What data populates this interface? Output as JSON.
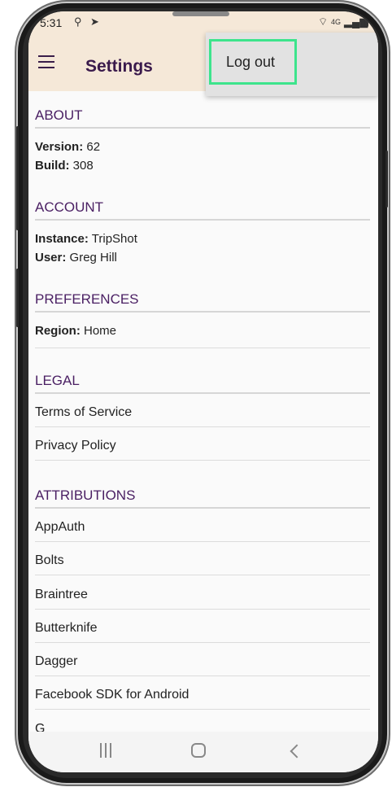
{
  "statusbar": {
    "time": "5:31",
    "location_icon": "location-icon",
    "nav_icon": "navigation-arrow-icon",
    "signal_text": "4G"
  },
  "appbar": {
    "title": "Settings",
    "menu_icon": "hamburger-menu-icon"
  },
  "overflow_menu": {
    "logout_label": "Log out"
  },
  "about": {
    "header": "ABOUT",
    "version_label": "Version:",
    "version_value": "62",
    "build_label": "Build:",
    "build_value": "308"
  },
  "account": {
    "header": "ACCOUNT",
    "instance_label": "Instance:",
    "instance_value": "TripShot",
    "user_label": "User:",
    "user_value": "Greg Hill"
  },
  "preferences": {
    "header": "PREFERENCES",
    "region_label": "Region:",
    "region_value": "Home"
  },
  "legal": {
    "header": "LEGAL",
    "items": [
      "Terms of Service",
      "Privacy Policy"
    ]
  },
  "attributions": {
    "header": "ATTRIBUTIONS",
    "items": [
      "AppAuth",
      "Bolts",
      "Braintree",
      "Butterknife",
      "Dagger",
      "Facebook SDK for Android",
      "G"
    ]
  },
  "navbar": {
    "recents_icon": "recents-icon",
    "home_icon": "home-icon",
    "back_icon": "back-icon"
  },
  "colors": {
    "appbar_bg": "#f5e8d8",
    "accent_purple": "#4a1f63",
    "highlight_green": "#3de48c"
  }
}
